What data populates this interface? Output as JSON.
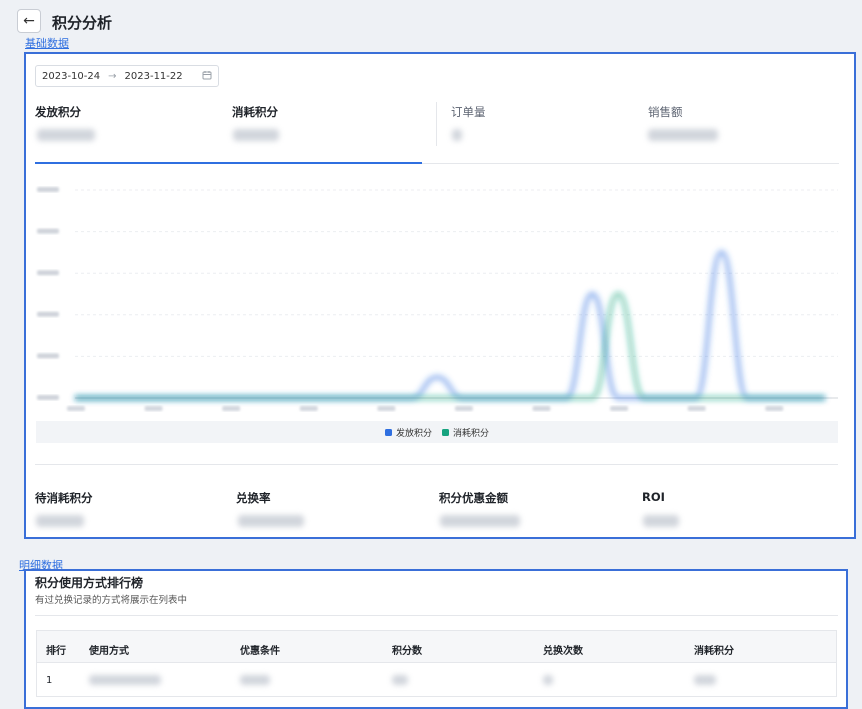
{
  "header": {
    "back_icon": "arrow-left-icon",
    "title": "积分分析"
  },
  "basic": {
    "section_label": "基础数据",
    "date_range": {
      "start": "2023-10-24",
      "sep": "→",
      "end": "2023-11-22",
      "icon": "calendar-icon"
    },
    "kpis_top": [
      {
        "label": "发放积分"
      },
      {
        "label": "消耗积分"
      },
      {
        "label": "订单量"
      },
      {
        "label": "销售额"
      }
    ],
    "legend": [
      {
        "label": "发放积分",
        "color": "#2f6fe0"
      },
      {
        "label": "消耗积分",
        "color": "#16a37f"
      }
    ],
    "kpis_bottom": [
      {
        "label": "待消耗积分"
      },
      {
        "label": "兑换率"
      },
      {
        "label": "积分优惠金额"
      },
      {
        "label": "ROI"
      }
    ]
  },
  "chart_data": {
    "type": "line",
    "series": [
      {
        "name": "发放积分",
        "color": "#2f6fe0",
        "values": [
          0,
          0,
          0,
          0,
          0,
          0,
          0,
          0,
          0,
          0,
          0,
          0,
          0,
          0,
          1,
          0,
          0,
          0,
          0,
          0,
          5,
          0,
          0,
          0,
          0,
          7,
          0,
          0,
          0,
          0
        ]
      },
      {
        "name": "消耗积分",
        "color": "#16a37f",
        "values": [
          0,
          0,
          0,
          0,
          0,
          0,
          0,
          0,
          0,
          0,
          0,
          0,
          0,
          0,
          0,
          0,
          0,
          0,
          0,
          0,
          0,
          5,
          0,
          0,
          0,
          0,
          0,
          0,
          0,
          0
        ]
      }
    ],
    "ylim": [
      0,
      10
    ],
    "grid": true,
    "legend_position": "bottom"
  },
  "detail": {
    "section_label": "明细数据",
    "rank_title": "积分使用方式排行榜",
    "rank_subtitle": "有过兑换记录的方式将展示在列表中",
    "columns": [
      "排行",
      "使用方式",
      "优惠条件",
      "积分数",
      "兑换次数",
      "消耗积分"
    ],
    "rows": [
      {
        "rank": "1"
      }
    ]
  }
}
